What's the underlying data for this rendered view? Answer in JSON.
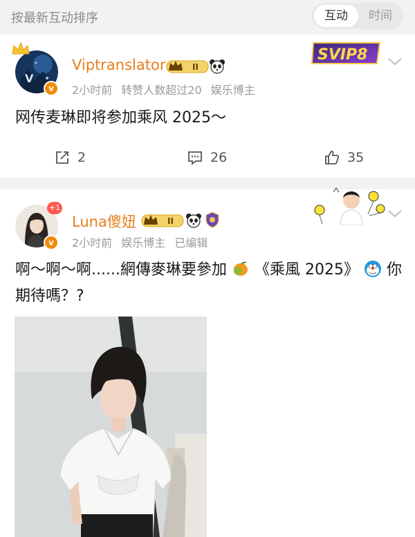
{
  "sortbar": {
    "label": "按最新互动排序",
    "tab_active": "互动",
    "tab_inactive": "时间"
  },
  "post1": {
    "username": "Viptranslator",
    "vip_level": "II",
    "time": "2小时前",
    "reposts_note": "转赞人数超过20",
    "tag": "娱乐博主",
    "badge_text": "SVIP8",
    "text": "网传麦琳即将参加乘风 2025～",
    "actions": {
      "share": "2",
      "comments": "26",
      "likes": "35"
    }
  },
  "post2": {
    "username": "Luna傻妞",
    "vip_level": "II",
    "avatar_badge": "+1",
    "time": "2小时前",
    "tag": "娱乐博主",
    "edited": "已编辑",
    "text_part1": "啊～啊～啊......網傳麥琳要參加",
    "text_part2": "《乘風 2025》",
    "text_part3": "你",
    "text_line2": "期待嗎？?"
  },
  "colors": {
    "username": "#e67e1a",
    "meta": "#9a9a9a",
    "background": "#f2f2f2",
    "vbadge": "#f28a00"
  },
  "icons": [
    "share-icon",
    "comment-icon",
    "like-icon",
    "chevron-down-icon",
    "panda-icon",
    "crown-icon",
    "mango-emoji",
    "doraemon-emoji"
  ]
}
